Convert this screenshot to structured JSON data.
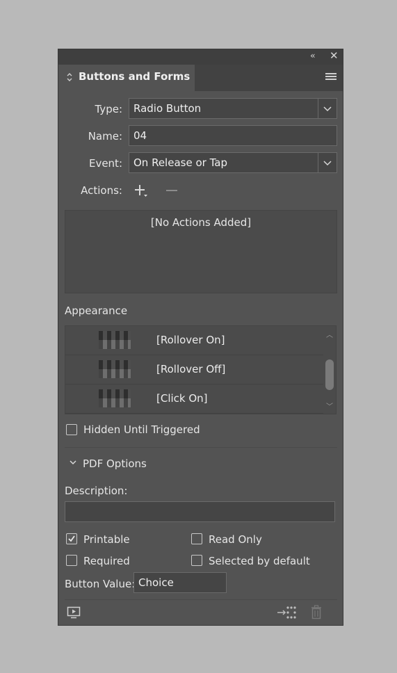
{
  "panel": {
    "title": "Buttons and Forms"
  },
  "fields": {
    "type_label": "Type:",
    "type_value": "Radio Button",
    "name_label": "Name:",
    "name_value": "04",
    "event_label": "Event:",
    "event_value": "On Release or Tap",
    "actions_label": "Actions:",
    "no_actions": "[No Actions Added]"
  },
  "appearance": {
    "label": "Appearance",
    "items": [
      "[Rollover On]",
      "[Rollover Off]",
      "[Click On]"
    ]
  },
  "hidden_until_triggered": {
    "label": "Hidden Until Triggered",
    "checked": false
  },
  "pdf_options": {
    "label": "PDF Options",
    "description_label": "Description:",
    "description_value": "",
    "printable": {
      "label": "Printable",
      "checked": true
    },
    "read_only": {
      "label": "Read Only",
      "checked": false
    },
    "required": {
      "label": "Required",
      "checked": false
    },
    "selected_by_default": {
      "label": "Selected by default",
      "checked": false
    },
    "button_value_label": "Button Value:",
    "button_value": "Choice"
  },
  "icons": {
    "collapse": "double-chevron-left-icon",
    "close": "close-icon",
    "menu": "hamburger-menu-icon",
    "add": "plus-icon",
    "remove": "minus-icon",
    "preview": "preview-icon",
    "convert": "convert-object-icon",
    "delete": "trash-icon"
  }
}
